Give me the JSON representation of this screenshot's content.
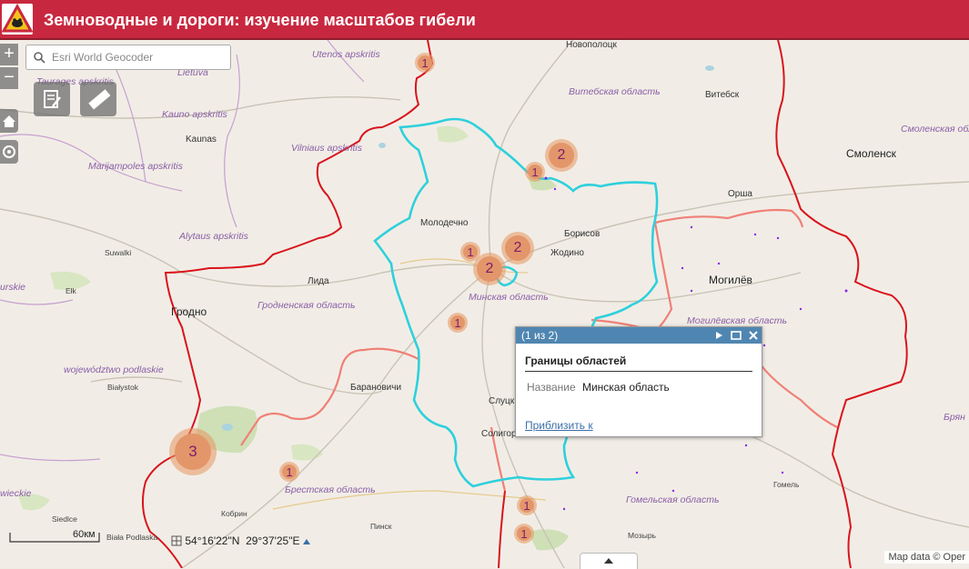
{
  "app": {
    "title": "Земноводные и дороги: изучение масштабов гибели",
    "accent_color": "#c8283f",
    "logo_icon": "frog-warning-sign-icon"
  },
  "search": {
    "placeholder": "Esri World Geocoder"
  },
  "zoom": {
    "in_label": "+",
    "out_label": "−"
  },
  "tools": [
    "edit-tool-icon",
    "measure-ruler-icon",
    "home-icon",
    "locate-icon"
  ],
  "map_labels": {
    "novopolotsk": "Новополоцк",
    "utenos": "Utenos apskritis",
    "taurages": "Taurages apskritis",
    "vitebsk_region": "Витебская область",
    "vitebsk": "Витебск",
    "kauno": "Kauno apskritis",
    "kaunas": "Kaunas",
    "vilniaus": "Vilniaus apskritis",
    "smolensk_region": "Смоленская область",
    "smolensk": "Смоленск",
    "marijampoles": "Marijampoles apskritis",
    "orsha": "Орша",
    "molodechno": "Молодечно",
    "borisov": "Борисов",
    "zhodino": "Жодино",
    "alytaus": "Alytaus apskritis",
    "suwalki": "Suwalki",
    "lida": "Лида",
    "mogilev": "Могилёв",
    "minsk_region": "Минская область",
    "elk": "Ełk",
    "grodno": "Гродно",
    "grodno_region": "Гродненская область",
    "mogilev_region": "Могилёвская область",
    "podlaskie": "województwo podlaskie",
    "baranovichi": "Барановичи",
    "bialystok": "Białystok",
    "slutsk": "Слуцк",
    "soligorsk": "Солигорск",
    "bryansk": "Брян",
    "brest_region": "Брестская область",
    "gomel": "Гомель",
    "gomel_region": "Гомельская область",
    "kobrin": "Кобрин",
    "siedlce": "Siedlce",
    "biala": "Biała Podlaska",
    "pinsk": "Пинск",
    "mozyr": "Мозырь",
    "urskie": "urskie",
    "wieckie": "wieckie",
    "lietuva": "Lietuva"
  },
  "clusters": [
    {
      "id": "c1",
      "count": "1"
    },
    {
      "id": "c2",
      "count": "2"
    },
    {
      "id": "c3",
      "count": "1"
    },
    {
      "id": "c4",
      "count": "1"
    },
    {
      "id": "c5",
      "count": "2"
    },
    {
      "id": "c6",
      "count": "2"
    },
    {
      "id": "c7",
      "count": "1"
    },
    {
      "id": "c8",
      "count": "3"
    },
    {
      "id": "c9",
      "count": "1"
    },
    {
      "id": "c10",
      "count": "1"
    },
    {
      "id": "c11",
      "count": "1"
    }
  ],
  "popup": {
    "counter": "(1 из 2)",
    "layer_title": "Границы областей",
    "field_name": "Название",
    "field_value": "Минская область",
    "zoom_link": "Приблизить к",
    "header_color": "#4f86b1"
  },
  "status": {
    "latitude": "54°16'22\"N",
    "longitude": "29°37'25\"E",
    "scale_label": "60км",
    "attribution": "Map data © Oper"
  }
}
